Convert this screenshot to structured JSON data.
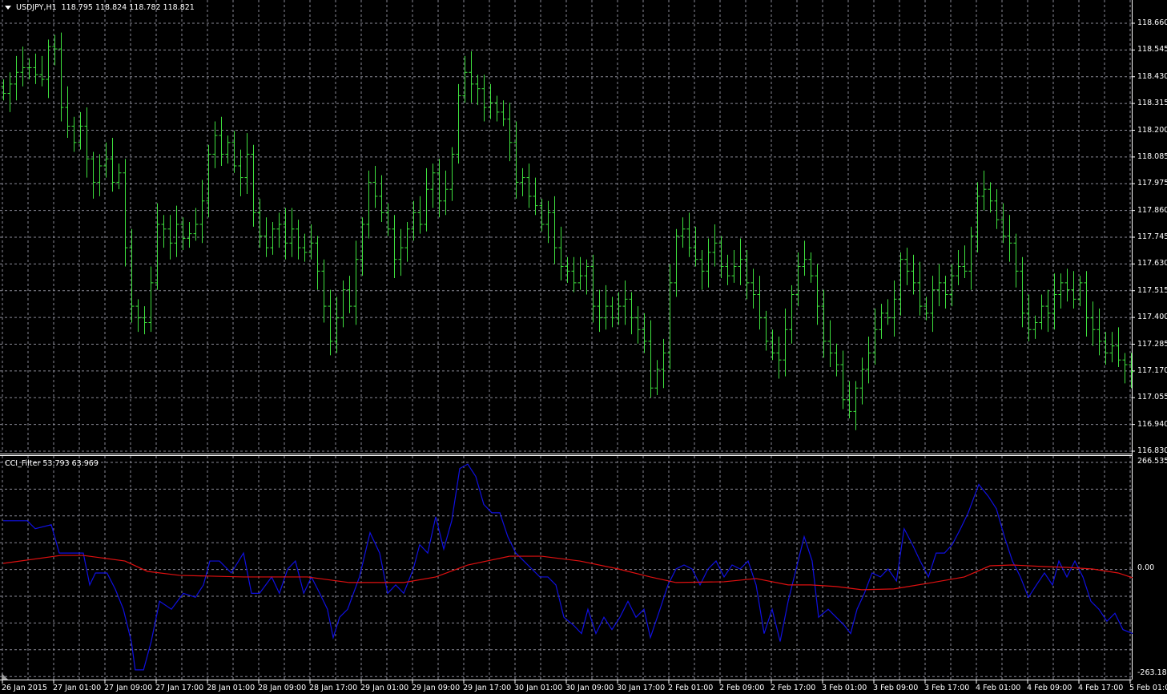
{
  "header": {
    "symbol": "USDJPY,H1",
    "ohlc": "118.795 118.824 118.782 118.821"
  },
  "indicator": {
    "title": "CCI_Filter 53.793 63.969"
  },
  "colors": {
    "bars": "#3ee03e",
    "cci_main": "#1010e0",
    "cci_signal": "#e01010",
    "grid": "#8a8a96",
    "axis": "#ffffff"
  },
  "price_axis": [
    "118.660",
    "118.545",
    "118.430",
    "118.315",
    "118.200",
    "118.085",
    "117.975",
    "117.860",
    "117.745",
    "117.630",
    "117.515",
    "117.400",
    "117.285",
    "117.170",
    "117.055",
    "116.940",
    "116.830"
  ],
  "cci_axis": [
    "266.535",
    "0.00",
    "-263.18"
  ],
  "time_axis": [
    "26 Jan 2015",
    "27 Jan 01:00",
    "27 Jan 09:00",
    "27 Jan 17:00",
    "28 Jan 01:00",
    "28 Jan 09:00",
    "28 Jan 17:00",
    "29 Jan 01:00",
    "29 Jan 09:00",
    "29 Jan 17:00",
    "30 Jan 01:00",
    "30 Jan 09:00",
    "30 Jan 17:00",
    "2 Feb 01:00",
    "2 Feb 09:00",
    "2 Feb 17:00",
    "3 Feb 01:00",
    "3 Feb 09:00",
    "3 Feb 17:00",
    "4 Feb 01:00",
    "4 Feb 09:00",
    "4 Feb 17:00",
    "5 Feb 01:00"
  ],
  "chart_data": [
    {
      "type": "line",
      "title": "USDJPY,H1 bar chart (closes)",
      "ylim": [
        116.83,
        118.66
      ],
      "close": [
        118.36,
        118.4,
        118.45,
        118.47,
        118.47,
        118.44,
        118.42,
        118.56,
        118.55,
        118.3,
        118.22,
        118.15,
        118.22,
        118.08,
        117.98,
        118.05,
        118.08,
        117.98,
        118.02,
        117.7,
        117.45,
        117.4,
        117.38,
        117.55,
        117.8,
        117.78,
        117.72,
        117.8,
        117.74,
        117.76,
        117.8,
        117.9,
        118.1,
        118.18,
        118.1,
        118.15,
        118.05,
        118.0,
        118.1,
        117.85,
        117.75,
        117.7,
        117.78,
        117.8,
        117.72,
        117.78,
        117.7,
        117.68,
        117.72,
        117.6,
        117.45,
        117.3,
        117.4,
        117.52,
        117.45,
        117.65,
        117.8,
        117.98,
        117.92,
        117.85,
        117.78,
        117.65,
        117.7,
        117.78,
        117.85,
        117.8,
        117.95,
        118.02,
        117.9,
        117.95,
        118.1,
        118.35,
        118.45,
        118.4,
        118.38,
        118.3,
        118.32,
        118.28,
        118.25,
        118.15,
        117.98,
        118.0,
        117.92,
        117.88,
        117.8,
        117.85,
        117.7,
        117.62,
        117.6,
        117.55,
        117.58,
        117.62,
        117.45,
        117.4,
        117.45,
        117.4,
        117.45,
        117.48,
        117.4,
        117.35,
        117.3,
        117.1,
        117.18,
        117.25,
        117.55,
        117.75,
        117.78,
        117.7,
        117.65,
        117.6,
        117.68,
        117.72,
        117.62,
        117.58,
        117.62,
        117.65,
        117.55,
        117.5,
        117.4,
        117.3,
        117.25,
        117.22,
        117.35,
        117.5,
        117.62,
        117.65,
        117.58,
        117.45,
        117.3,
        117.25,
        117.2,
        117.05,
        117.0,
        117.1,
        117.18,
        117.25,
        117.35,
        117.42,
        117.4,
        117.48,
        117.65,
        117.6,
        117.55,
        117.45,
        117.42,
        117.52,
        117.55,
        117.5,
        117.58,
        117.62,
        117.6,
        117.75,
        117.92,
        117.95,
        117.9,
        117.82,
        117.75,
        117.72,
        117.6,
        117.42,
        117.35,
        117.38,
        117.45,
        117.42,
        117.5,
        117.55,
        117.52,
        117.48,
        117.55,
        117.4,
        117.35,
        117.3,
        117.25,
        117.28,
        117.22,
        117.2,
        117.17
      ]
    },
    {
      "type": "line",
      "title": "CCI_Filter",
      "ylim": [
        -263.18,
        266.535
      ],
      "series": [
        {
          "name": "cci_main",
          "points": [
            [
              0,
              119
            ],
            [
              3.75,
              119
            ],
            [
              5,
              99
            ],
            [
              7.5,
              109
            ],
            [
              8.75,
              38
            ],
            [
              12.5,
              38
            ],
            [
              13.5,
              -42
            ],
            [
              14.4,
              -12
            ],
            [
              16.2,
              -12
            ],
            [
              17.5,
              -53
            ],
            [
              18.75,
              -103
            ],
            [
              20,
              -184
            ],
            [
              20.6,
              -255
            ],
            [
              21.9,
              -255
            ],
            [
              23.1,
              -184
            ],
            [
              24.4,
              -83
            ],
            [
              26.25,
              -103
            ],
            [
              28.1,
              -63
            ],
            [
              30,
              -73
            ],
            [
              31.25,
              -42
            ],
            [
              32.25,
              18
            ],
            [
              33.75,
              18
            ],
            [
              35.6,
              -12
            ],
            [
              37.5,
              38
            ],
            [
              38.75,
              -63
            ],
            [
              40,
              -63
            ],
            [
              41.9,
              -22
            ],
            [
              43.1,
              -63
            ],
            [
              44.4,
              -2
            ],
            [
              45.6,
              18
            ],
            [
              46.9,
              -63
            ],
            [
              48.1,
              -22
            ],
            [
              49.4,
              -63
            ],
            [
              50.6,
              -103
            ],
            [
              51.5,
              -174
            ],
            [
              52.5,
              -123
            ],
            [
              53.75,
              -103
            ],
            [
              55.6,
              -22
            ],
            [
              57.25,
              89
            ],
            [
              58.75,
              38
            ],
            [
              60,
              -63
            ],
            [
              61.25,
              -42
            ],
            [
              62.5,
              -63
            ],
            [
              64,
              -2
            ],
            [
              65,
              59
            ],
            [
              66.25,
              38
            ],
            [
              67.5,
              129
            ],
            [
              68.75,
              48
            ],
            [
              70,
              119
            ],
            [
              71.25,
              250
            ],
            [
              72.5,
              261
            ],
            [
              73.75,
              230
            ],
            [
              75,
              160
            ],
            [
              76.25,
              139
            ],
            [
              77.5,
              139
            ],
            [
              78.75,
              79
            ],
            [
              80,
              38
            ],
            [
              81.25,
              18
            ],
            [
              82.5,
              -2
            ],
            [
              83.75,
              -22
            ],
            [
              85,
              -22
            ],
            [
              86.25,
              -42
            ],
            [
              87.5,
              -123
            ],
            [
              89,
              -143
            ],
            [
              90.25,
              -164
            ],
            [
              91.25,
              -103
            ],
            [
              92.5,
              -164
            ],
            [
              93.75,
              -123
            ],
            [
              95,
              -154
            ],
            [
              96.25,
              -123
            ],
            [
              97.5,
              -83
            ],
            [
              98.75,
              -123
            ],
            [
              100,
              -103
            ],
            [
              101,
              -174
            ],
            [
              102.5,
              -103
            ],
            [
              103.75,
              -42
            ],
            [
              105,
              -2
            ],
            [
              106.25,
              8
            ],
            [
              107.5,
              -2
            ],
            [
              108.75,
              -42
            ],
            [
              110,
              -2
            ],
            [
              111.25,
              18
            ],
            [
              112.5,
              -22
            ],
            [
              113.75,
              8
            ],
            [
              115,
              -2
            ],
            [
              116.25,
              18
            ],
            [
              117.5,
              -42
            ],
            [
              118.75,
              -164
            ],
            [
              120,
              -103
            ],
            [
              121.25,
              -184
            ],
            [
              122.5,
              -83
            ],
            [
              123.75,
              -2
            ],
            [
              125,
              79
            ],
            [
              126.25,
              18
            ],
            [
              127.25,
              -123
            ],
            [
              128.75,
              -103
            ],
            [
              130,
              -123
            ],
            [
              131.25,
              -143
            ],
            [
              132.25,
              -164
            ],
            [
              133.25,
              -103
            ],
            [
              134.4,
              -63
            ],
            [
              135.6,
              -12
            ],
            [
              136.9,
              -22
            ],
            [
              138.1,
              -2
            ],
            [
              139.4,
              -32
            ],
            [
              140.6,
              99
            ],
            [
              141.9,
              59
            ],
            [
              143.1,
              18
            ],
            [
              144.4,
              -22
            ],
            [
              145.6,
              38
            ],
            [
              146.9,
              38
            ],
            [
              148.1,
              59
            ],
            [
              149.4,
              99
            ],
            [
              150.6,
              139
            ],
            [
              152.25,
              210
            ],
            [
              153.75,
              180
            ],
            [
              155,
              149
            ],
            [
              156.25,
              79
            ],
            [
              157.5,
              18
            ],
            [
              158.75,
              -22
            ],
            [
              160,
              -73
            ],
            [
              161.25,
              -42
            ],
            [
              162.5,
              -12
            ],
            [
              163.75,
              -42
            ],
            [
              164.75,
              18
            ],
            [
              166,
              -22
            ],
            [
              167.25,
              18
            ],
            [
              168.5,
              -22
            ],
            [
              169.75,
              -83
            ],
            [
              171,
              -103
            ],
            [
              172.25,
              -133
            ],
            [
              173.5,
              -113
            ],
            [
              174.75,
              -154
            ],
            [
              176.25,
              -164
            ]
          ]
        },
        {
          "name": "cci_signal",
          "points": [
            [
              0,
              12
            ],
            [
              9,
              32
            ],
            [
              12.5,
              32
            ],
            [
              19,
              18
            ],
            [
              22.5,
              -8
            ],
            [
              27.5,
              -18
            ],
            [
              37.5,
              -22
            ],
            [
              47.5,
              -22
            ],
            [
              54,
              -36
            ],
            [
              62.5,
              -36
            ],
            [
              67.5,
              -22
            ],
            [
              72.5,
              8
            ],
            [
              79,
              30
            ],
            [
              84,
              30
            ],
            [
              90,
              18
            ],
            [
              96,
              -2
            ],
            [
              101,
              -22
            ],
            [
              105,
              -36
            ],
            [
              112.5,
              -34
            ],
            [
              117.5,
              -26
            ],
            [
              122.5,
              -42
            ],
            [
              126,
              -42
            ],
            [
              130,
              -46
            ],
            [
              134,
              -54
            ],
            [
              139,
              -52
            ],
            [
              145,
              -36
            ],
            [
              150,
              -22
            ],
            [
              154,
              6
            ],
            [
              157.5,
              8
            ],
            [
              162.5,
              4
            ],
            [
              166,
              2
            ],
            [
              170,
              -2
            ],
            [
              174,
              -12
            ],
            [
              176.25,
              -24
            ]
          ]
        }
      ]
    }
  ]
}
